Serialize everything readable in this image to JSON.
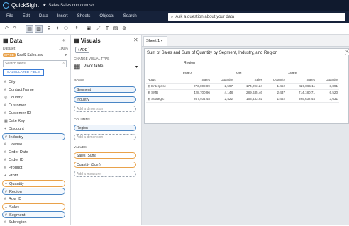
{
  "app": {
    "name": "QuickSight",
    "document_title": "Sales Sales.con.com.sb"
  },
  "menu": [
    "File",
    "Edit",
    "Data",
    "Insert",
    "Sheets",
    "Objects",
    "Search"
  ],
  "ask": {
    "placeholder": "Ask a question about your data"
  },
  "toolbar": {
    "undo": "↶",
    "redo": "↷"
  },
  "data_panel": {
    "title": "Data",
    "dataset_label": "Dataset",
    "dataset_pct": "100%",
    "dataset_badge": "SPICE",
    "dataset_name": "SaaS-Sales.csv",
    "search_placeholder": "Search fields",
    "calc_field": "CALCULATED FIELD",
    "fields": [
      {
        "icon": "#",
        "label": "City"
      },
      {
        "icon": "#",
        "label": "Contact Name"
      },
      {
        "icon": "◎",
        "label": "Country"
      },
      {
        "icon": "#",
        "label": "Customer"
      },
      {
        "icon": "#",
        "label": "Customer ID"
      },
      {
        "icon": "▦",
        "label": "Date Key"
      },
      {
        "icon": "+",
        "label": "Discount"
      },
      {
        "icon": "#",
        "label": "Industry"
      },
      {
        "icon": "#",
        "label": "License"
      },
      {
        "icon": "#",
        "label": "Order Date"
      },
      {
        "icon": "#",
        "label": "Order ID"
      },
      {
        "icon": "#",
        "label": "Product"
      },
      {
        "icon": "+",
        "label": "Profit"
      },
      {
        "icon": "+",
        "label": "Quantity"
      },
      {
        "icon": "#",
        "label": "Region"
      },
      {
        "icon": "#",
        "label": "Row ID"
      },
      {
        "icon": "+",
        "label": "Sales"
      },
      {
        "icon": "#",
        "label": "Segment"
      },
      {
        "icon": "#",
        "label": "Subregion"
      }
    ]
  },
  "visuals_panel": {
    "title": "Visuals",
    "add_label": "+ ADD",
    "type_section": "CHANGE VISUAL TYPE",
    "type_name": "Pivot table",
    "rows_label": "ROWS",
    "rows": [
      "Segment",
      "Industry"
    ],
    "columns_label": "COLUMNS",
    "columns": [
      "Region"
    ],
    "values_label": "VALUES",
    "values": [
      "Sales (Sum)",
      "Quantity (Sum)"
    ],
    "add_dimension": "Add a dimension",
    "add_measure": "Add a measure"
  },
  "sheet": {
    "tab_label": "Sheet 1",
    "add_tab": "+"
  },
  "pivot": {
    "title": "Sum of Sales and Sum of Quantity by Segment, Industry, and Region",
    "column_header": "Region",
    "rows_header": "Rows",
    "regions": [
      "EMEA",
      "APJ",
      "AMER"
    ],
    "measure_headers": [
      "Sales",
      "Quantity",
      "Sales",
      "Quantity",
      "Sales",
      "Quantity"
    ],
    "rows": [
      {
        "label": "Enterprise",
        "values": [
          "273,008.89",
          "2,597",
          "174,093.24",
          "1,452",
          "419,865.11",
          "3,891"
        ]
      },
      {
        "label": "SMB",
        "values": [
          "428,700.96",
          "4,148",
          "289,635.46",
          "2,437",
          "714,180.71",
          "6,520"
        ]
      },
      {
        "label": "Strategic",
        "values": [
          "267,404.48",
          "2,422",
          "163,433.92",
          "1,452",
          "395,632.44",
          "3,631"
        ]
      }
    ]
  }
}
